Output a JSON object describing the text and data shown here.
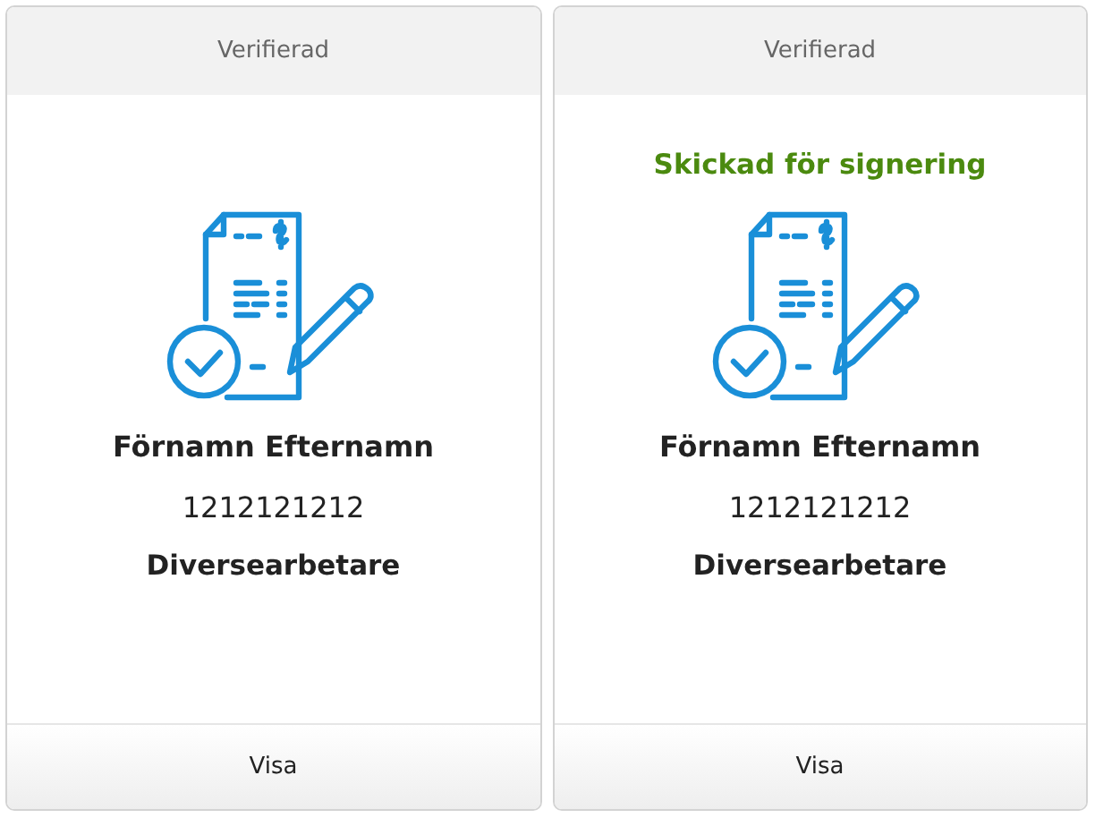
{
  "cards": [
    {
      "header": "Verifierad",
      "name": "Förnamn Efternamn",
      "number": "1212121212",
      "role": "Diversearbetare",
      "button": "Visa"
    },
    {
      "header": "Verifierad",
      "status": "Skickad för signering",
      "name": "Förnamn Efternamn",
      "number": "1212121212",
      "role": "Diversearbetare",
      "button": "Visa"
    }
  ]
}
